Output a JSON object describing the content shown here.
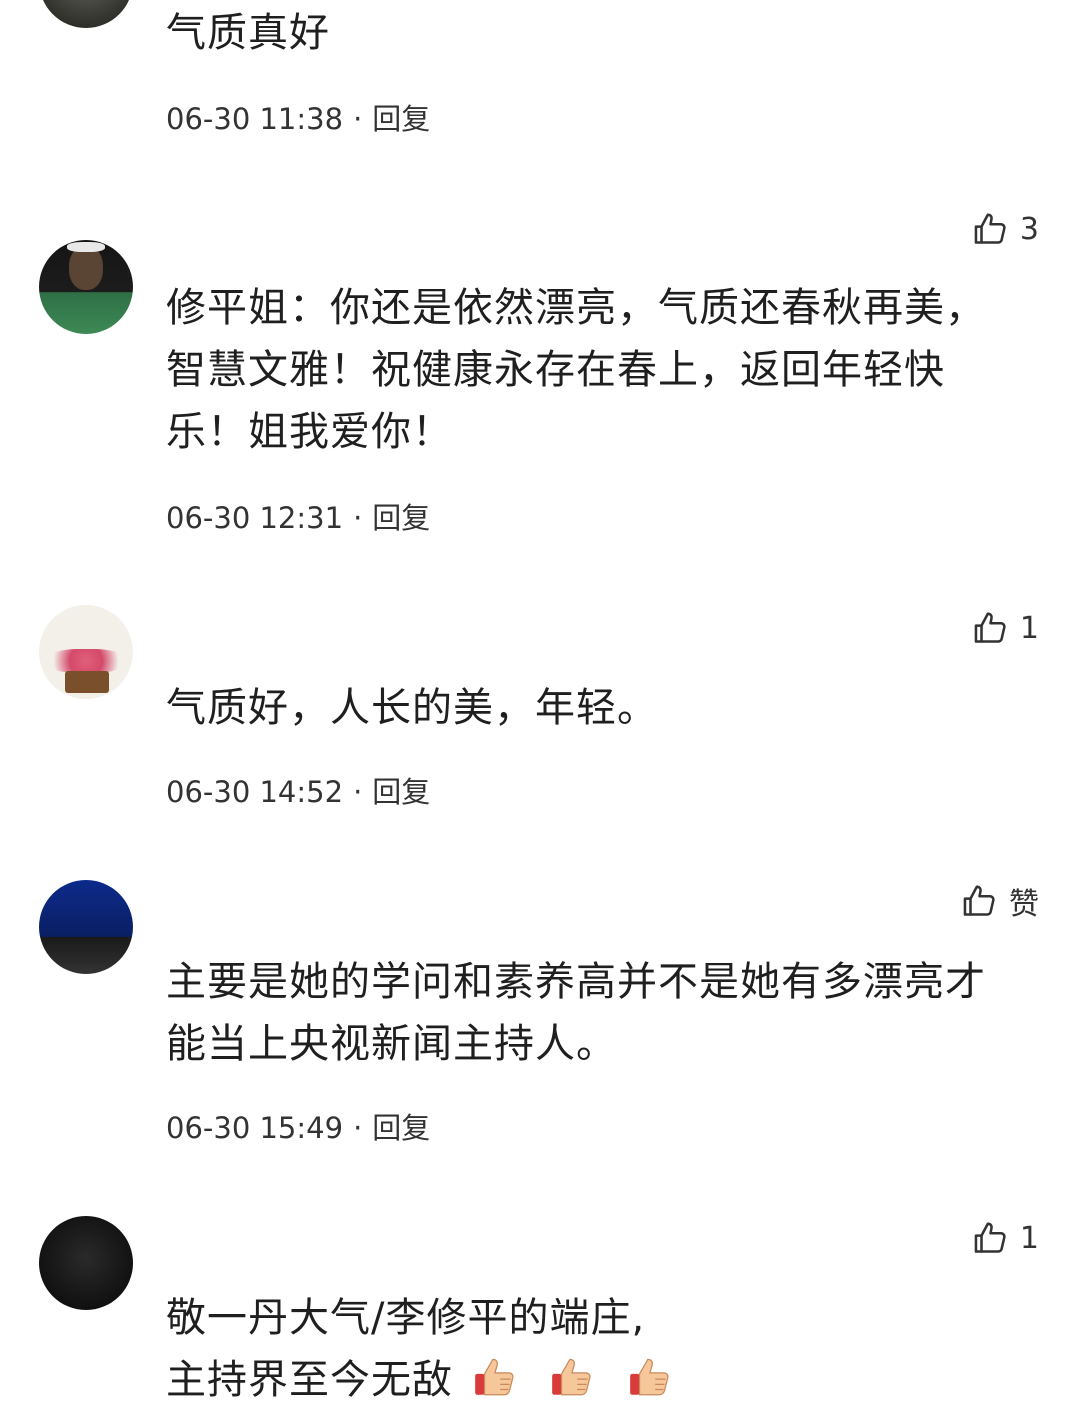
{
  "comments": [
    {
      "text": "气质真好",
      "time": "06-30 11:38",
      "reply_label": "回复"
    },
    {
      "text": "修平姐：你还是依然漂亮，气质还春秋再美，智慧文雅！祝健康永存在春上，返回年轻快乐！姐我爱你！",
      "time": "06-30 12:31",
      "reply_label": "回复",
      "likes": "3"
    },
    {
      "text": "气质好，人长的美，年轻。",
      "time": "06-30 14:52",
      "reply_label": "回复",
      "likes": "1"
    },
    {
      "text": "主要是她的学问和素养高并不是她有多漂亮才能当上央视新闻主持人。",
      "time": "06-30 15:49",
      "reply_label": "回复",
      "likes": "赞"
    },
    {
      "line1": "敬一丹大气/李修平的端庄,",
      "line2": "主持界至今无敌",
      "likes": "1"
    }
  ],
  "separator": "·",
  "icons": {
    "like": "thumbs-up-icon",
    "emoji": "thumbs-up-emoji-icon"
  },
  "colors": {
    "text": "#1f1f1f",
    "meta": "#333333",
    "icon": "#333333"
  }
}
